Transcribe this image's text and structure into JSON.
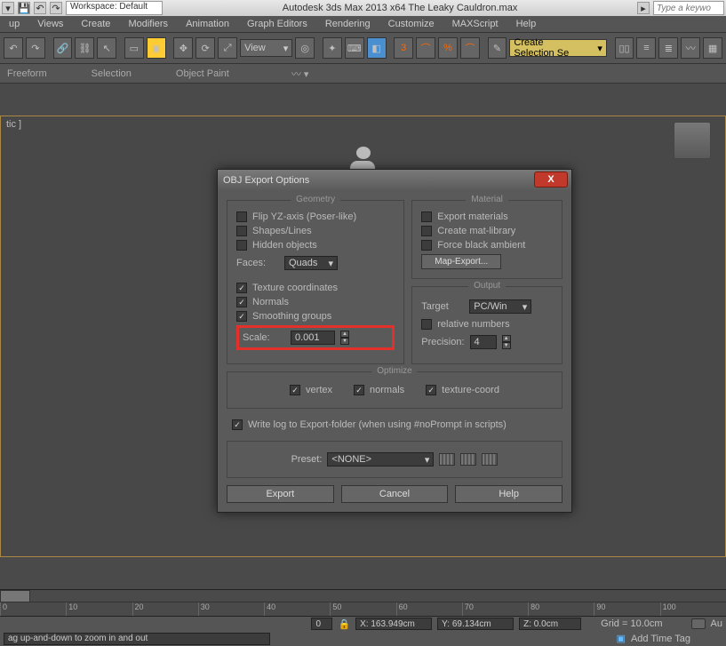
{
  "titlebar": {
    "workspace_label": "Workspace: Default",
    "title": "Autodesk 3ds Max 2013 x64     The Leaky Cauldron.max",
    "search_placeholder": "Type a keywo"
  },
  "menubar": [
    "up",
    "Views",
    "Create",
    "Modifiers",
    "Animation",
    "Graph Editors",
    "Rendering",
    "Customize",
    "MAXScript",
    "Help"
  ],
  "toolbar": {
    "view_dd": "View",
    "sel_set": "Create Selection Se"
  },
  "ribbon": {
    "items": [
      "Freeform",
      "Selection",
      "Object Paint"
    ]
  },
  "viewport": {
    "label": "tic ]"
  },
  "dialog": {
    "title": "OBJ Export Options",
    "geometry": {
      "legend": "Geometry",
      "flip": "Flip YZ-axis (Poser-like)",
      "shapes": "Shapes/Lines",
      "hidden": "Hidden objects",
      "faces_lbl": "Faces:",
      "faces_val": "Quads",
      "tex": "Texture coordinates",
      "normals": "Normals",
      "smooth": "Smoothing groups",
      "scale_lbl": "Scale:",
      "scale_val": "0.001"
    },
    "material": {
      "legend": "Material",
      "export": "Export materials",
      "create": "Create mat-library",
      "force": "Force black ambient",
      "mapexport": "Map-Export..."
    },
    "output": {
      "legend": "Output",
      "target_lbl": "Target",
      "target_val": "PC/Win",
      "relative": "relative numbers",
      "precision_lbl": "Precision:",
      "precision_val": "4"
    },
    "optimize": {
      "legend": "Optimize",
      "vertex": "vertex",
      "normals": "normals",
      "tex": "texture-coord"
    },
    "writelog": "Write log to Export-folder (when using #noPrompt in scripts)",
    "preset_lbl": "Preset:",
    "preset_val": "<NONE>",
    "export_btn": "Export",
    "cancel_btn": "Cancel",
    "help_btn": "Help"
  },
  "timeline": {
    "ticks": [
      "0",
      "10",
      "20",
      "30",
      "40",
      "50",
      "60",
      "70",
      "80",
      "90",
      "100"
    ]
  },
  "status": {
    "frame": "0",
    "x": "X: 163.949cm",
    "y": "Y: 69.134cm",
    "z": "Z: 0.0cm",
    "grid": "Grid = 10.0cm",
    "auto": "Au",
    "hint": "ag up-and-down to zoom in and out",
    "timetag": "Add Time Tag"
  }
}
